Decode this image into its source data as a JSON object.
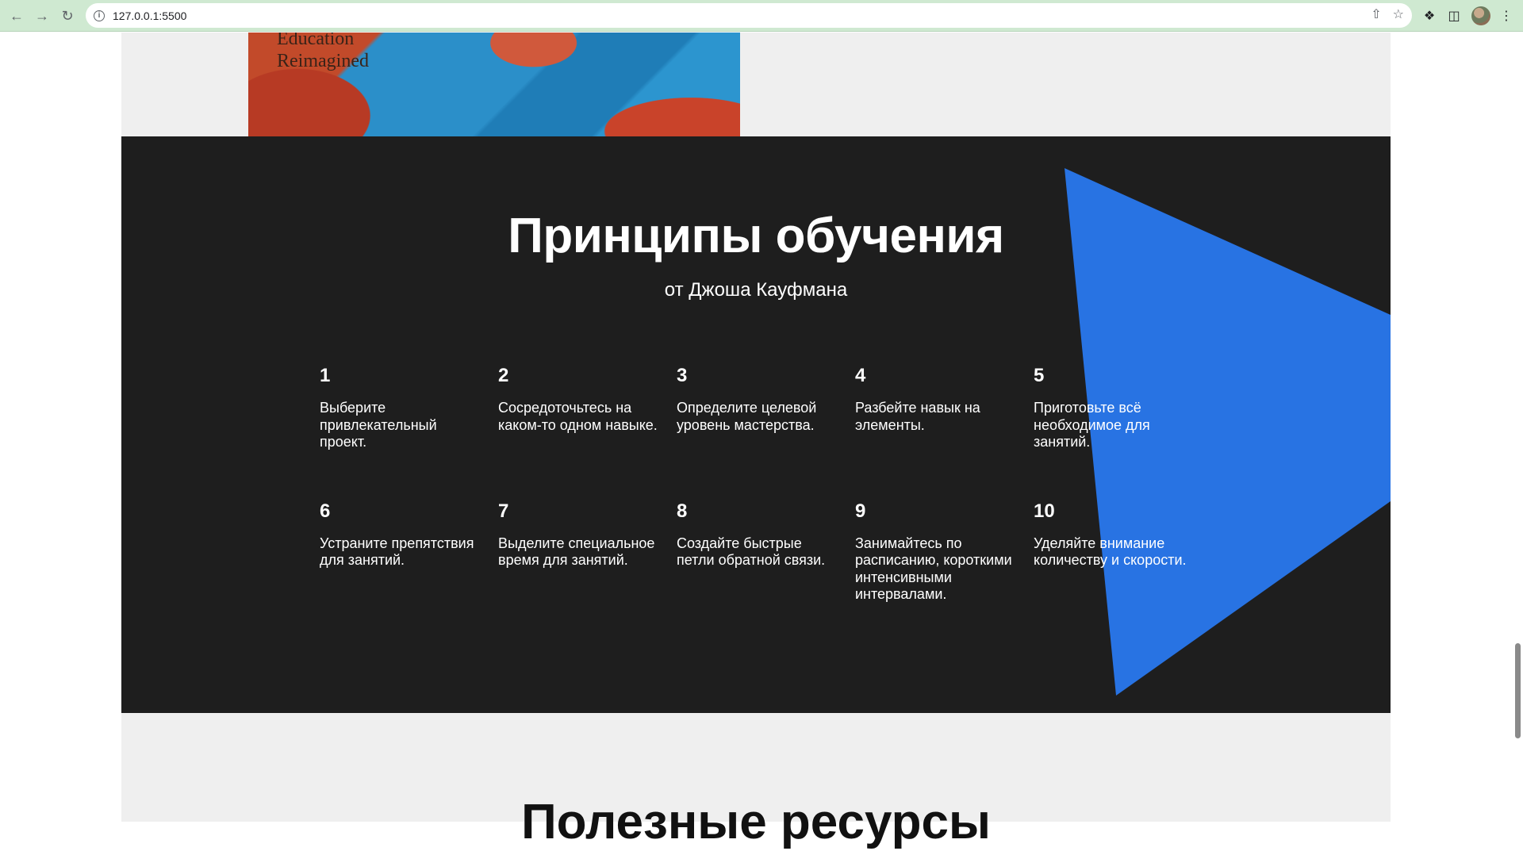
{
  "browser": {
    "url": "127.0.0.1:5500",
    "back_icon": "arrow-left",
    "forward_icon": "arrow-right",
    "reload_icon": "reload"
  },
  "book_cover": {
    "title_line1": "Education",
    "title_line2": "Reimagined"
  },
  "principles": {
    "title": "Принципы обучения",
    "subtitle": "от Джоша Кауфмана",
    "accent_color": "#2873e3",
    "background_color": "#1e1e1e",
    "items": [
      {
        "num": "1",
        "text": "Выберите привлекательный проект."
      },
      {
        "num": "2",
        "text": "Сосредоточьтесь на каком-то одном навыке."
      },
      {
        "num": "3",
        "text": "Определите целевой уровень мастерства."
      },
      {
        "num": "4",
        "text": "Разбейте навык на элементы."
      },
      {
        "num": "5",
        "text": "Приготовьте всё необходимое для занятий."
      },
      {
        "num": "6",
        "text": "Устраните препятствия для занятий."
      },
      {
        "num": "7",
        "text": "Выделите специальное время для занятий."
      },
      {
        "num": "8",
        "text": "Создайте быстрые петли обратной связи."
      },
      {
        "num": "9",
        "text": "Занимайтесь по расписанию, короткими интенсивными интервалами."
      },
      {
        "num": "10",
        "text": "Уделяйте внимание количеству и скорости."
      }
    ]
  },
  "resources": {
    "title": "Полезные ресурсы"
  }
}
